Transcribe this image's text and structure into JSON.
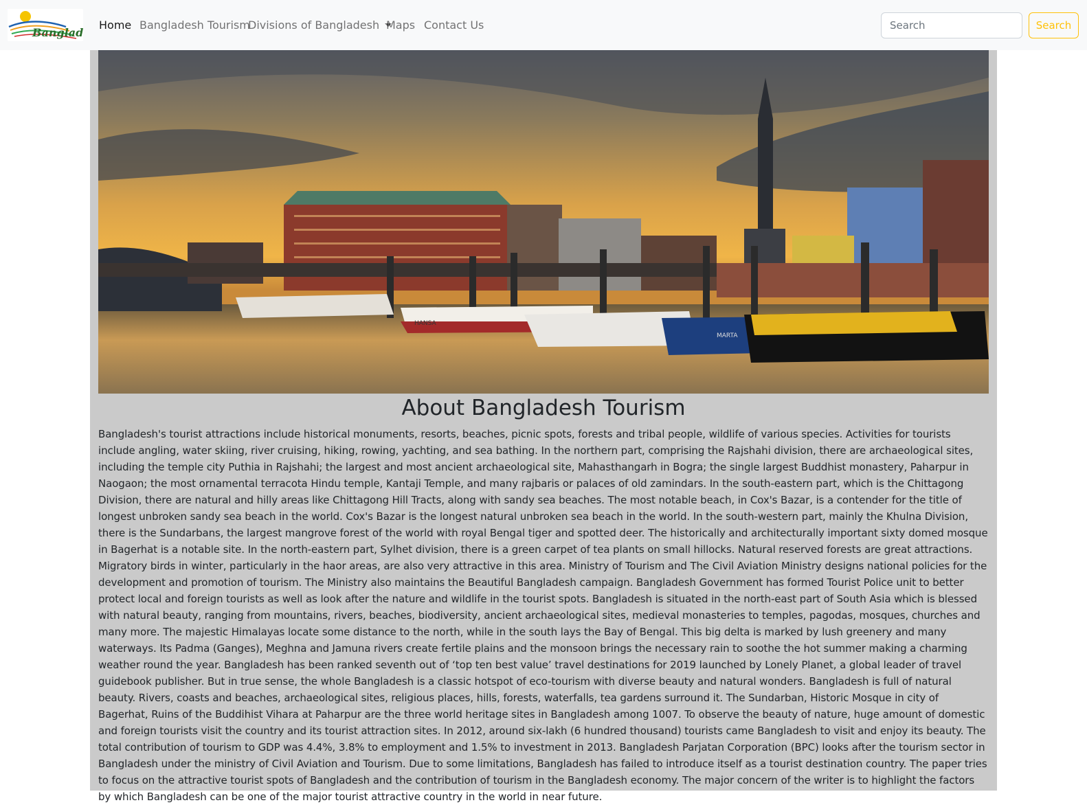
{
  "navbar": {
    "logo_text": "Bangladesh",
    "links": [
      {
        "label": "Home",
        "active": true
      },
      {
        "label": "Bangladesh Tourism",
        "active": false
      },
      {
        "label": "Divisions of Bangladesh",
        "active": false,
        "dropdown": true
      },
      {
        "label": "Maps",
        "active": false
      },
      {
        "label": "Contact Us",
        "active": false
      }
    ],
    "search": {
      "placeholder": "Search",
      "value": "",
      "button_label": "Search"
    }
  },
  "hero": {
    "image": "harbor-sunset-photo",
    "boat_names": [
      "HANSA",
      "MARTA"
    ]
  },
  "main": {
    "title": "About Bangladesh Tourism",
    "body": "Bangladesh's tourist attractions include historical monuments, resorts, beaches, picnic spots, forests and tribal people, wildlife of various species. Activities for tourists include angling, water skiing, river cruising, hiking, rowing, yachting, and sea bathing. In the northern part, comprising the Rajshahi division, there are archaeological sites, including the temple city Puthia in Rajshahi; the largest and most ancient archaeological site, Mahasthangarh in Bogra; the single largest Buddhist monastery, Paharpur in Naogaon; the most ornamental terracota Hindu temple, Kantaji Temple, and many rajbaris or palaces of old zamindars. In the south-eastern part, which is the Chittagong Division, there are natural and hilly areas like Chittagong Hill Tracts, along with sandy sea beaches. The most notable beach, in Cox's Bazar, is a contender for the title of longest unbroken sandy sea beach in the world. Cox's Bazar is the longest natural unbroken sea beach in the world. In the south-western part, mainly the Khulna Division, there is the Sundarbans, the largest mangrove forest of the world with royal Bengal tiger and spotted deer. The historically and architecturally important sixty domed mosque in Bagerhat is a notable site. In the north-eastern part, Sylhet division, there is a green carpet of tea plants on small hillocks. Natural reserved forests are great attractions. Migratory birds in winter, particularly in the haor areas, are also very attractive in this area. Ministry of Tourism and The Civil Aviation Ministry designs national policies for the development and promotion of tourism. The Ministry also maintains the Beautiful Bangladesh campaign. Bangladesh Government has formed Tourist Police unit to better protect local and foreign tourists as well as look after the nature and wildlife in the tourist spots. Bangladesh is situated in the north-east part of South Asia which is blessed with natural beauty, ranging from mountains, rivers, beaches, biodiversity, ancient archaeological sites, medieval monasteries to temples, pagodas, mosques, churches and many more. The majestic Himalayas locate some distance to the north, while in the south lays the Bay of Bengal. This big delta is marked by lush greenery and many waterways. Its Padma (Ganges), Meghna and Jamuna rivers create fertile plains and the monsoon brings the necessary rain to soothe the hot summer making a charming weather round the year. Bangladesh has been ranked seventh out of ‘top ten best value’ travel destinations for 2019 launched by Lonely Planet, a global leader of travel guidebook publisher. But in true sense, the whole Bangladesh is a classic hotspot of eco-tourism with diverse beauty and natural wonders. Bangladesh is full of natural beauty. Rivers, coasts and beaches, archaeological sites, religious places, hills, forests, waterfalls, tea gardens surround it. The Sundarban, Historic Mosque in city of Bagerhat, Ruins of the Buddihist Vihara at Paharpur are the three world heritage sites in Bangladesh among 1007. To observe the beauty of nature, huge amount of domestic and foreign tourists visit the country and its tourist attraction sites. In 2012, around six-lakh (6 hundred thousand) tourists came Bangladesh to visit and enjoy its beauty. The total contribution of tourism to GDP was 4.4%, 3.8% to employment and 1.5% to investment in 2013. Bangladesh Parjatan Corporation (BPC) looks after the tourism sector in Bangladesh under the ministry of Civil Aviation and Tourism. Due to some limitations, Bangladesh has failed to introduce itself as a tourist destination country. The paper tries to focus on the attractive tourist spots of Bangladesh and the contribution of tourism in the Bangladesh economy. The major concern of the writer is to highlight the factors by which Bangladesh can be one of the major tourist attractive country in the world in near future."
  },
  "colors": {
    "navbar_bg": "#f8f9fa",
    "content_bg": "#cacaca",
    "search_button": "#ffc107",
    "logo_sun": "#f5c400",
    "logo_text": "#2a7a2a"
  }
}
